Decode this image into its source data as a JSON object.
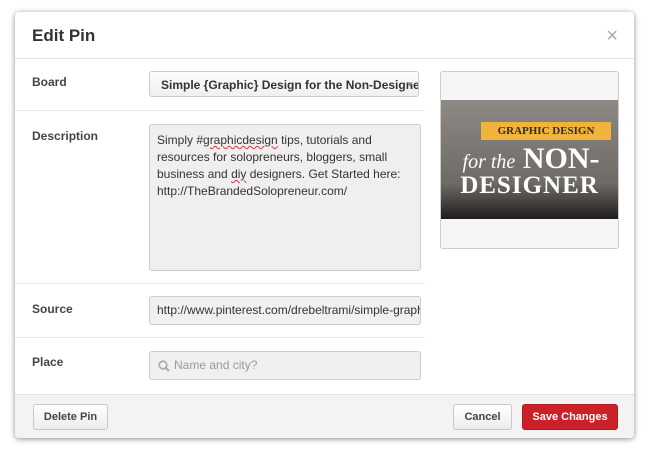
{
  "dialog": {
    "title": "Edit Pin",
    "close": "×"
  },
  "form": {
    "board": {
      "label": "Board",
      "value": "Simple {Graphic} Design for the Non-Designer"
    },
    "description": {
      "label": "Description",
      "value_parts": [
        "Simply #",
        "graphicdesign",
        " tips, tutorials and resources for solopreneurs, bloggers, small business and ",
        "diy",
        " designers. Get Started here: http://TheBrandedSolopreneur.com/"
      ]
    },
    "source": {
      "label": "Source",
      "value": "http://www.pinterest.com/drebeltrami/simple-graphic"
    },
    "place": {
      "label": "Place",
      "placeholder": "Name and city?"
    }
  },
  "preview": {
    "banner": "GRAPHIC DESIGN",
    "line2_script": "for the",
    "line2": "NON-",
    "line3": "DESIGNER"
  },
  "footer": {
    "delete": "Delete Pin",
    "cancel": "Cancel",
    "save": "Save Changes"
  },
  "colors": {
    "save": "#cb2027",
    "banner": "#f0b43c"
  }
}
